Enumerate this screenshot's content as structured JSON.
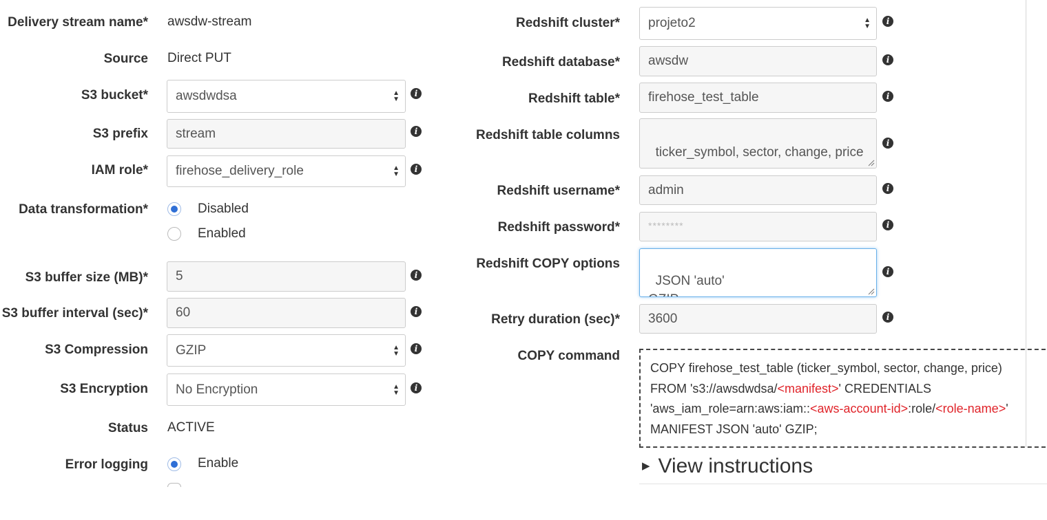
{
  "left": {
    "delivery_stream_name": {
      "label": "Delivery stream name*",
      "value": "awsdw-stream"
    },
    "source": {
      "label": "Source",
      "value": "Direct PUT"
    },
    "s3_bucket": {
      "label": "S3 bucket*",
      "value": "awsdwdsa"
    },
    "s3_prefix": {
      "label": "S3 prefix",
      "value": "stream"
    },
    "iam_role": {
      "label": "IAM role*",
      "value": "firehose_delivery_role"
    },
    "data_transformation": {
      "label": "Data transformation*",
      "options": [
        "Disabled",
        "Enabled"
      ],
      "selected": "Disabled"
    },
    "s3_buffer_size": {
      "label": "S3 buffer size (MB)*",
      "value": "5"
    },
    "s3_buffer_interval": {
      "label": "S3 buffer interval (sec)*",
      "value": "60"
    },
    "s3_compression": {
      "label": "S3 Compression",
      "value": "GZIP"
    },
    "s3_encryption": {
      "label": "S3 Encryption",
      "value": "No Encryption"
    },
    "status": {
      "label": "Status",
      "value": "ACTIVE"
    },
    "error_logging": {
      "label": "Error logging",
      "options": [
        "Enable"
      ],
      "selected": "Enable"
    }
  },
  "right": {
    "redshift_cluster": {
      "label": "Redshift cluster*",
      "value": "projeto2"
    },
    "redshift_database": {
      "label": "Redshift database*",
      "value": "awsdw"
    },
    "redshift_table": {
      "label": "Redshift table*",
      "value": "firehose_test_table"
    },
    "redshift_table_columns": {
      "label": "Redshift table columns",
      "value": "ticker_symbol, sector, change, price"
    },
    "redshift_username": {
      "label": "Redshift username*",
      "value": "admin"
    },
    "redshift_password": {
      "label": "Redshift password*",
      "value": "********"
    },
    "redshift_copy_options": {
      "label": "Redshift COPY options",
      "value": "JSON 'auto'\nGZIP"
    },
    "retry_duration": {
      "label": "Retry duration (sec)*",
      "value": "3600"
    },
    "copy_command": {
      "label": "COPY command",
      "line1": "COPY firehose_test_table (ticker_symbol, sector, change, price)",
      "line2_a": "FROM 's3://awsdwdsa/",
      "line2_red": "<manifest>",
      "line2_b": "' CREDENTIALS",
      "line3_a": "'aws_iam_role=arn:aws:iam::",
      "line3_red1": "<aws-account-id>",
      "line3_b": ":role/",
      "line3_red2": "<role-name>",
      "line3_c": "'",
      "line4": "MANIFEST JSON 'auto' GZIP;"
    },
    "view_instructions": "View instructions"
  },
  "colors": {
    "accent": "#2f6fd6",
    "placeholder_red": "#e0242a",
    "focus_border": "#66afe9"
  },
  "icons": {
    "info": "info-icon",
    "select": "select-arrows-icon",
    "expand": "caret-right-icon"
  }
}
